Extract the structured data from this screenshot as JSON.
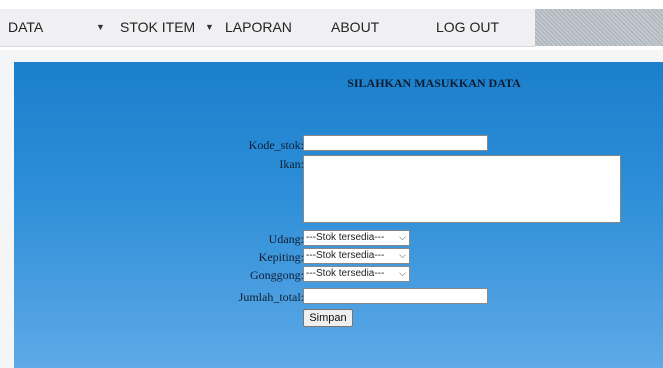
{
  "nav": {
    "data": "DATA",
    "stok_item": "STOK ITEM",
    "laporan": "LAPORAN",
    "about": "ABOUT",
    "logout": "LOG OUT",
    "caret": "▼"
  },
  "form": {
    "heading": "SILAHKAN MASUKKAN DATA",
    "kode_stok_label": "Kode_stok:",
    "ikan_label": "Ikan:",
    "udang_label": "Udang:",
    "kepiting_label": "Kepiting:",
    "gonggong_label": "Gonggong:",
    "jumlah_total_label": "Jumlah_total:",
    "udang_value": "---Stok tersedia---",
    "kepiting_value": "---Stok tersedia---",
    "gonggong_value": "---Stok tersedia---",
    "submit": "Simpan",
    "chevron": "⌵"
  }
}
